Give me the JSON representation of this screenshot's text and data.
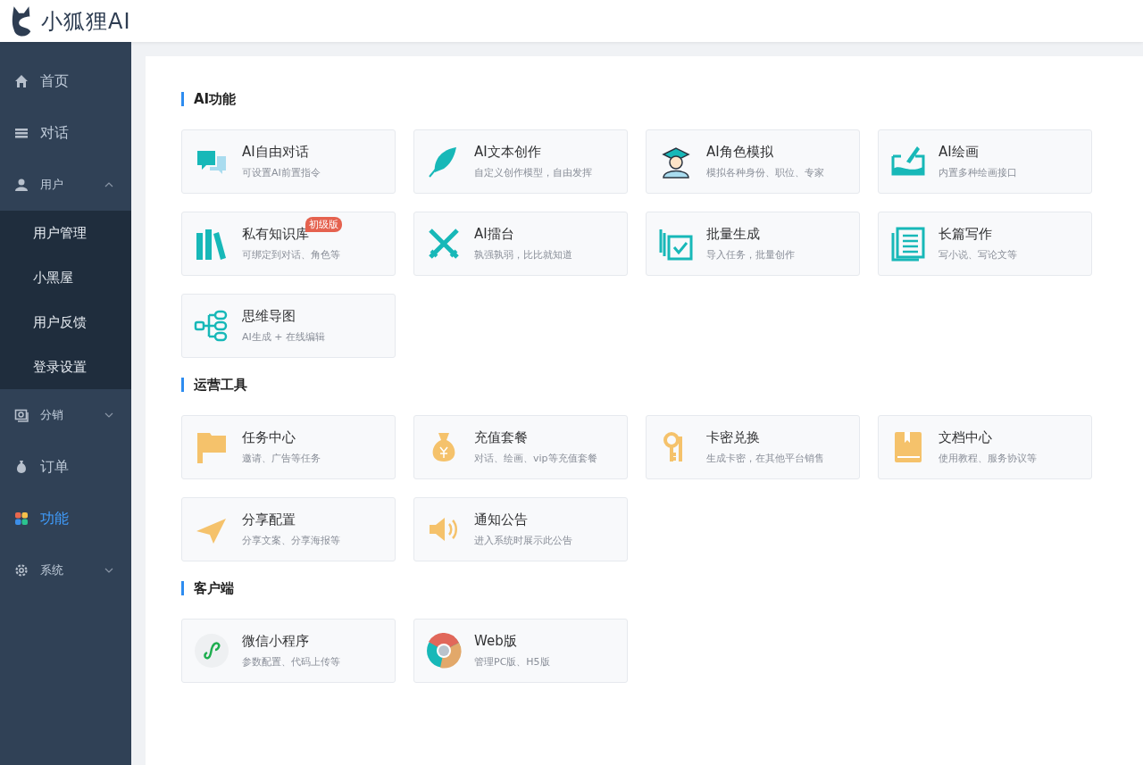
{
  "header": {
    "logo_text": "小狐狸AI"
  },
  "sidebar": {
    "items": [
      {
        "label": "首页",
        "selected": false
      },
      {
        "label": "对话",
        "selected": false
      },
      {
        "label": "用户",
        "selected": false,
        "expanded": true,
        "children": [
          {
            "label": "用户管理",
            "selected": false
          },
          {
            "label": "小黑屋",
            "selected": false
          },
          {
            "label": "用户反馈",
            "selected": false
          },
          {
            "label": "登录设置",
            "selected": false
          }
        ]
      },
      {
        "label": "分销",
        "selected": false,
        "expanded": false
      },
      {
        "label": "订单",
        "selected": false
      },
      {
        "label": "功能",
        "selected": true
      },
      {
        "label": "系统",
        "selected": false,
        "expanded": false
      }
    ]
  },
  "sections": [
    {
      "title": "AI功能",
      "cards": [
        {
          "title": "AI自由对话",
          "desc": "可设置AI前置指令"
        },
        {
          "title": "AI文本创作",
          "desc": "自定义创作模型，自由发挥"
        },
        {
          "title": "AI角色模拟",
          "desc": "模拟各种身份、职位、专家"
        },
        {
          "title": "AI绘画",
          "desc": "内置多种绘画接口"
        },
        {
          "title": "私有知识库",
          "desc": "可绑定到对话、角色等",
          "badge": "初级版"
        },
        {
          "title": "AI擂台",
          "desc": "孰强孰弱，比比就知道"
        },
        {
          "title": "批量生成",
          "desc": "导入任务，批量创作"
        },
        {
          "title": "长篇写作",
          "desc": "写小说、写论文等"
        },
        {
          "title": "思维导图",
          "desc": "AI生成 + 在线编辑"
        }
      ]
    },
    {
      "title": "运营工具",
      "cards": [
        {
          "title": "任务中心",
          "desc": "邀请、广告等任务"
        },
        {
          "title": "充值套餐",
          "desc": "对话、绘画、vip等充值套餐"
        },
        {
          "title": "卡密兑换",
          "desc": "生成卡密，在其他平台销售"
        },
        {
          "title": "文档中心",
          "desc": "使用教程、服务协议等"
        },
        {
          "title": "分享配置",
          "desc": "分享文案、分享海报等"
        },
        {
          "title": "通知公告",
          "desc": "进入系统时展示此公告"
        }
      ]
    },
    {
      "title": "客户端",
      "cards": [
        {
          "title": "微信小程序",
          "desc": "参数配置、代码上传等"
        },
        {
          "title": "Web版",
          "desc": "管理PC版、H5版"
        }
      ]
    }
  ]
}
